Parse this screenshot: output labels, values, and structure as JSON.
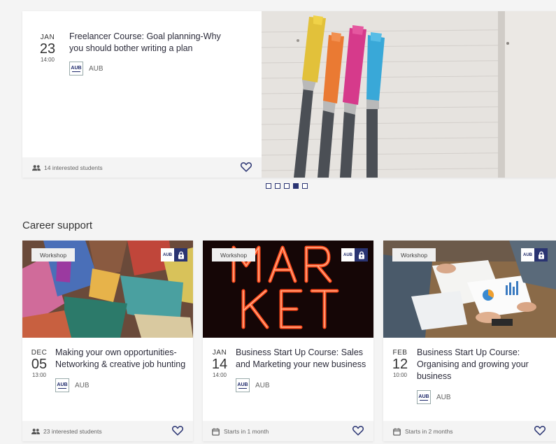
{
  "featured": {
    "date": {
      "month": "JAN",
      "day": "23",
      "time": "14:00"
    },
    "title": "Freelancer Course: Goal planning-Why you should bother writing a plan",
    "org_logo": "AUB",
    "org": "AUB",
    "footer": "14 interested students"
  },
  "carousel": {
    "count": 5,
    "active_index": 3
  },
  "section": {
    "title": "Career support"
  },
  "cards": [
    {
      "tag": "Workshop",
      "badge_logo": "AUB",
      "date": {
        "month": "DEC",
        "day": "05",
        "time": "13:00"
      },
      "title": "Making your own opportunities- Networking & creative job hunting",
      "org_logo": "AUB",
      "org": "AUB",
      "footer": "23 interested students",
      "footer_icon": "people-icon"
    },
    {
      "tag": "Workshop",
      "badge_logo": "AUB",
      "date": {
        "month": "JAN",
        "day": "14",
        "time": "14:00"
      },
      "title": "Business Start Up Course: Sales and Marketing your new business",
      "org_logo": "AUB",
      "org": "AUB",
      "footer": "Starts in 1 month",
      "footer_icon": "calendar-icon"
    },
    {
      "tag": "Workshop",
      "badge_logo": "AUB",
      "date": {
        "month": "FEB",
        "day": "12",
        "time": "10:00"
      },
      "title": "Business Start Up Course: Organising and growing your business",
      "org_logo": "AUB",
      "org": "AUB",
      "footer": "Starts in 2 months",
      "footer_icon": "calendar-icon"
    }
  ],
  "colors": {
    "accent": "#2a3472",
    "page_bg": "#f4f4f4"
  }
}
